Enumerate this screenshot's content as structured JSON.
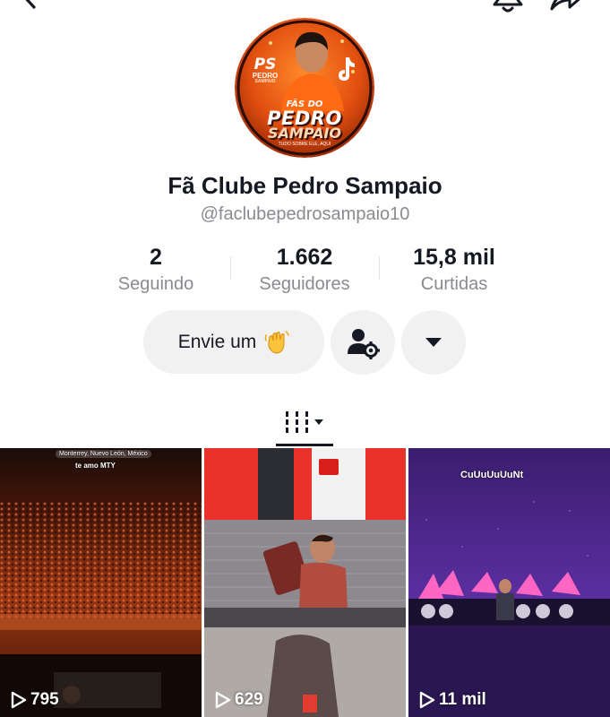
{
  "profile": {
    "name": "Fã Clube Pedro Sampaio",
    "username": "@faclubepedrosampaio10",
    "avatar": {
      "logo_text": "PS",
      "logo_sub": "PEDRO",
      "logo_sub2": "SAMPAIO",
      "line1": "FÃS DO",
      "line2": "PEDRO",
      "line3": "SAMPAIO",
      "tagline": "TUDO SOBRE ELE, AQUI"
    }
  },
  "stats": {
    "following": {
      "value": "2",
      "label": "Seguindo"
    },
    "followers": {
      "value": "1.662",
      "label": "Seguidores"
    },
    "likes": {
      "value": "15,8 mil",
      "label": "Curtidas"
    }
  },
  "actions": {
    "message_label": "Envie um"
  },
  "videos": [
    {
      "views": "795",
      "location_text": "Monterrey, Nuevo León, México",
      "caption": "te amo MTY"
    },
    {
      "views": "629"
    },
    {
      "views": "11 mil",
      "caption": "CuUuUuUuNt"
    }
  ],
  "colors": {
    "text_primary": "#161823",
    "text_secondary": "#8a8b91",
    "button_bg": "#f1f1f2",
    "avatar_orange": "#f05a16"
  },
  "icons": {
    "back": "chevron-left-icon",
    "notifications": "bell-icon",
    "share": "share-arrow-icon",
    "wave": "waving-hand-icon",
    "user_settings": "user-settings-icon",
    "more": "caret-down-icon",
    "videos_tab": "grid-bars-icon",
    "views": "play-icon"
  }
}
